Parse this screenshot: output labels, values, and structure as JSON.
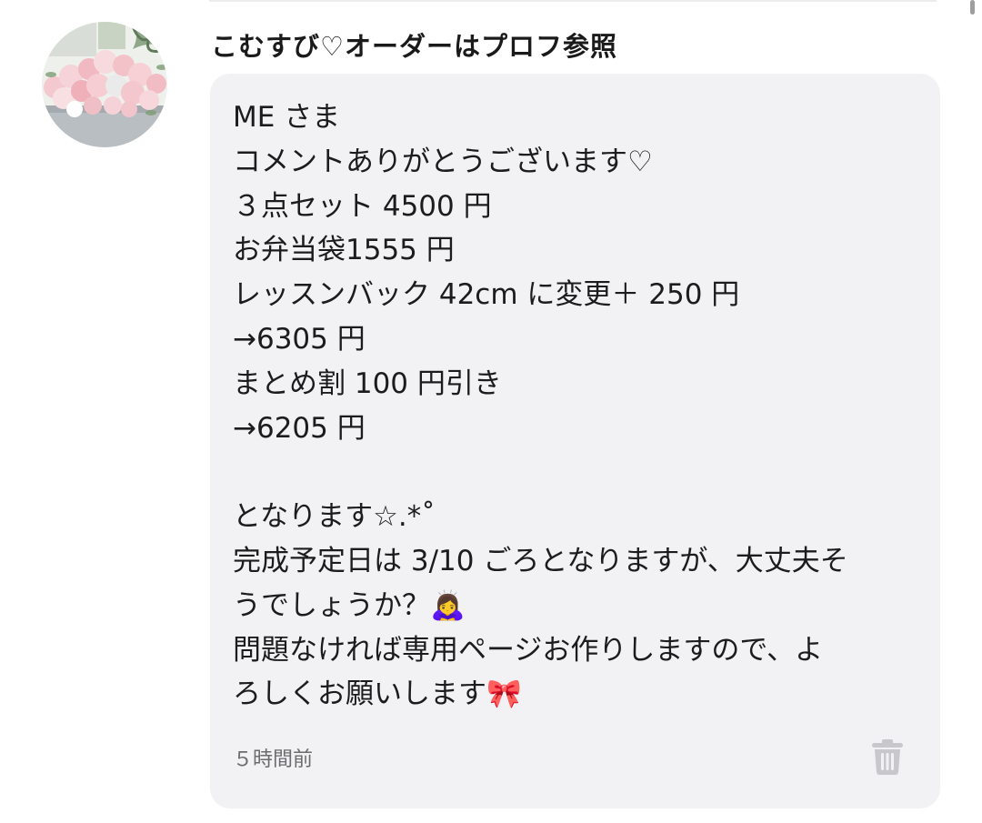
{
  "comment": {
    "author": "こむすび♡オーダーはプロフ参照",
    "avatar_icon": "flower-bouquet-avatar",
    "message_lines": [
      "ME さま",
      "コメントありがとうございます♡",
      "３点セット 4500 円",
      "お弁当袋1555 円",
      "レッスンバック 42cm に変更＋ 250 円",
      "→6305 円",
      "まとめ割 100 円引き",
      "→6205 円",
      "",
      "となります☆.*˚",
      "完成予定日は 3/10 ごろとなりますが、大丈夫そ",
      "うでしょうか？🙇‍♀️",
      "問題なければ専用ページお作りしますので、よ",
      "ろしくお願いします🎀"
    ],
    "timestamp": "５時間前",
    "delete_icon": "trash-icon"
  },
  "colors": {
    "bubble_bg": "#f2f2f4",
    "text": "#1c1c1e",
    "muted": "#6b6b6e",
    "icon": "#c7c7cc"
  }
}
